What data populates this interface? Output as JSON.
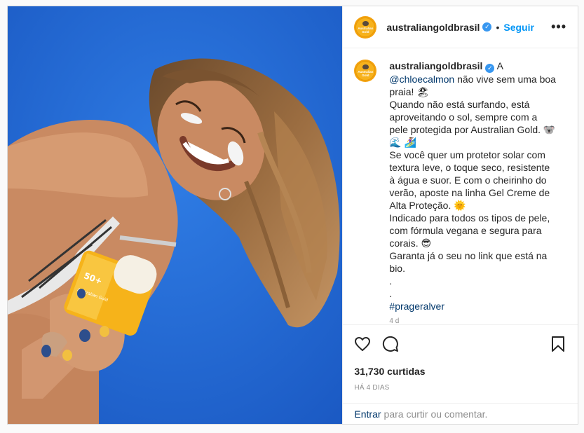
{
  "post": {
    "username": "australiangoldbrasil",
    "verified_icon": "verified-badge-icon",
    "separator": "•",
    "follow_label": "Seguir",
    "more_label": "•••",
    "avatar_brand": "Australian Gold"
  },
  "caption": {
    "username": "australiangoldbrasil",
    "lines": [
      "A",
      "@chloecalmon",
      "não vive sem uma boa praia! 🏖",
      "Quando não está surfando, está aproveitando o sol, sempre com a pele protegida por Australian Gold. 🐨 🌊 🏄‍♀️",
      "Se você quer um protetor solar com textura leve, o toque seco, resistente à água e suor. E com o cheirinho do verão, aposte na linha Gel Creme de Alta Proteção. 🌞",
      "Indicado para todos os tipos de pele, com fórmula vegana e segura para corais. 😎",
      "Garanta já o seu no link que está na bio.",
      ".",
      ".",
      "#prageralver"
    ],
    "age": "4 d"
  },
  "actions": {
    "like_icon": "heart-icon",
    "comment_icon": "comment-icon",
    "save_icon": "bookmark-icon",
    "likes": "31,730 curtidas",
    "date": "HÁ 4 DIAS"
  },
  "comment_bar": {
    "login_label": "Entrar",
    "rest": "para curtir ou comentar."
  },
  "colors": {
    "sky": "#2a73dc",
    "accent": "#0095f6",
    "avatar": "#f4a20e"
  },
  "photo": {
    "product_label": "50+",
    "product_brand": "Australian Gold"
  }
}
